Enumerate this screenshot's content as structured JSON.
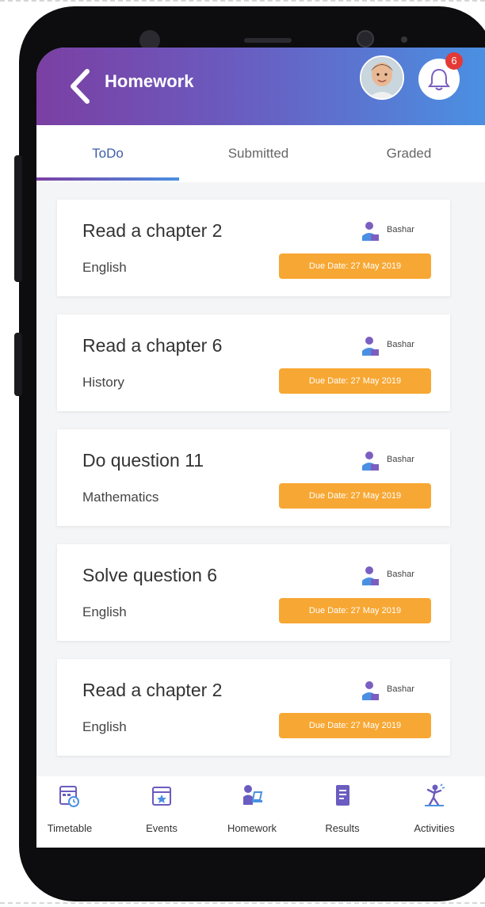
{
  "header": {
    "title": "Homework",
    "notification_count": "6"
  },
  "tabs": [
    {
      "label": "ToDo",
      "active": true
    },
    {
      "label": "Submitted",
      "active": false
    },
    {
      "label": "Graded",
      "active": false
    }
  ],
  "homework": [
    {
      "title": "Read a chapter 2",
      "subject": "English",
      "teacher": "Bashar",
      "due": "Due Date: 27 May 2019"
    },
    {
      "title": "Read a chapter 6",
      "subject": "History",
      "teacher": "Bashar",
      "due": "Due Date: 27 May 2019"
    },
    {
      "title": "Do question 11",
      "subject": "Mathematics",
      "teacher": "Bashar",
      "due": "Due Date: 27 May 2019"
    },
    {
      "title": "Solve question 6",
      "subject": "English",
      "teacher": "Bashar",
      "due": "Due Date: 27 May 2019"
    },
    {
      "title": "Read a chapter 2",
      "subject": "English",
      "teacher": "Bashar",
      "due": "Due Date: 27 May 2019"
    }
  ],
  "bottom_nav": [
    {
      "label": "Timetable",
      "icon": "calendar-clock-icon"
    },
    {
      "label": "Events",
      "icon": "calendar-star-icon"
    },
    {
      "label": "Homework",
      "icon": "student-desk-icon"
    },
    {
      "label": "Results",
      "icon": "results-sheet-icon"
    },
    {
      "label": "Activities",
      "icon": "activity-person-icon"
    }
  ],
  "colors": {
    "header_start": "#7b3fa3",
    "header_end": "#4a90e2",
    "due_badge": "#f7a733",
    "active_tab": "#3e5ea8",
    "notification_badge": "#e53935"
  }
}
